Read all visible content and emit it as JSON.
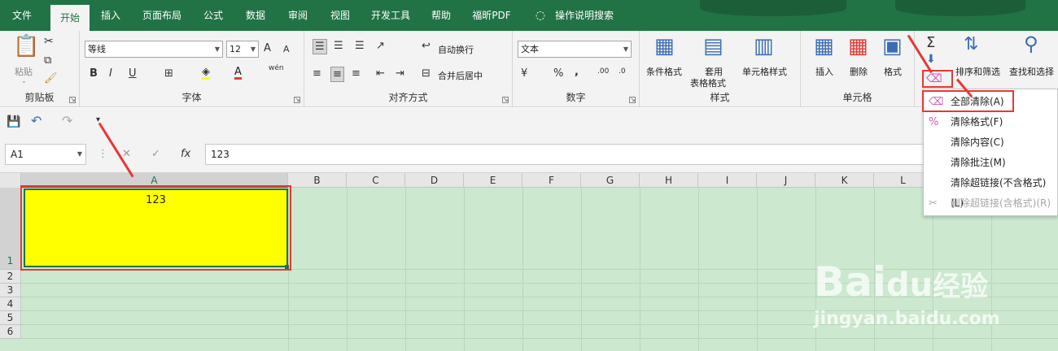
{
  "menu_tabs": [
    "文件",
    "开始",
    "插入",
    "页面布局",
    "公式",
    "数据",
    "审阅",
    "视图",
    "开发工具",
    "帮助",
    "福昕PDF",
    "操作说明搜索"
  ],
  "clipboard": {
    "paste": "粘贴",
    "label": "剪贴板"
  },
  "font": {
    "name": "等线",
    "size": "12",
    "label": "字体",
    "bold": "B",
    "italic": "I",
    "underline": "U",
    "grow": "A",
    "shrink": "A",
    "pinyin": "wén"
  },
  "align": {
    "wrap": "自动换行",
    "merge": "合并后居中",
    "label": "对齐方式"
  },
  "number": {
    "format": "文本",
    "label": "数字",
    "percent": "%",
    "comma": ",",
    "inc": ".00",
    "dec": ".0"
  },
  "styles": {
    "conditional": "条件格式",
    "table_line1": "套用",
    "table_line2": "表格格式",
    "cell_styles": "单元格样式",
    "label": "样式"
  },
  "cells": {
    "insert": "插入",
    "delete": "删除",
    "format": "格式",
    "label": "单元格"
  },
  "editing": {
    "sigma": "Σ",
    "sort": "排序和筛选",
    "find": "查找和选择"
  },
  "namebox": "A1",
  "formula": "123",
  "fx": "fx",
  "columns": [
    "A",
    "B",
    "C",
    "D",
    "E",
    "F",
    "G",
    "H",
    "I",
    "J",
    "K",
    "L"
  ],
  "rows": [
    "1",
    "2",
    "3",
    "4",
    "5",
    "6"
  ],
  "cell_a1": "123",
  "clear_menu": [
    "全部清除(A)",
    "清除格式(F)",
    "清除内容(C)",
    "清除批注(M)",
    "清除超链接(不含格式)(L)",
    "删除超链接(含格式)(R)"
  ],
  "watermark": {
    "brand": "Bai",
    "paw": "du",
    "suffix": "经验",
    "url": "jingyan.baidu.com"
  },
  "colors": {
    "excel_green": "#217346",
    "grid_bg": "#cce8cf",
    "highlight": "#ffff00",
    "annotation": "#e53935"
  }
}
